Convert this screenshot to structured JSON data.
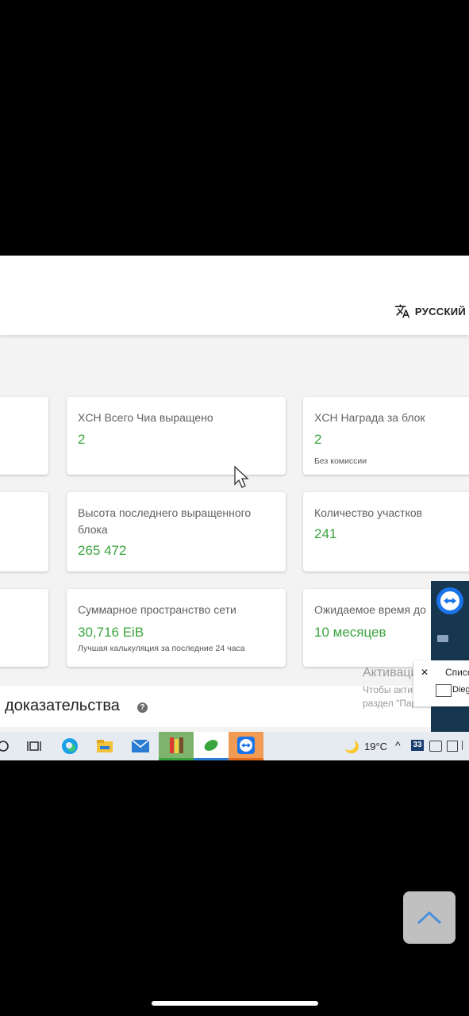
{
  "header": {
    "language_label": "РУССКИЙ",
    "language_icon": "translate-icon"
  },
  "stats": [
    {
      "label": "XCH Всего Чиа выращено",
      "value": "2",
      "note": ""
    },
    {
      "label": "XCH Награда за блок",
      "value": "2",
      "note": "Без комиссии"
    },
    {
      "label": "Высота последнего выращенного блока",
      "value": "265 472",
      "note": ""
    },
    {
      "label": "Количество участков",
      "value": "241",
      "note": ""
    },
    {
      "label": "Суммарное пространство сети",
      "value": "30,716 EiB",
      "note": "Лучшая калькуляция за последние 24 часа"
    },
    {
      "label": "Ожидаемое время до",
      "value": "10 месяцев",
      "note": ""
    }
  ],
  "section": {
    "title": "доказательства",
    "help_icon": "help-icon"
  },
  "windows_activation": {
    "title": "Активация Windo",
    "line1": "Чтобы активиров",
    "line2": "раздел \"Параметры\"."
  },
  "popup": {
    "label": "Списс",
    "user": "Diego"
  },
  "taskbar": {
    "weather": "19°C",
    "badge": "33",
    "icons": [
      "search-icon",
      "task-view-icon",
      "edge-icon",
      "file-explorer-icon",
      "mail-icon",
      "app-icon",
      "chia-icon",
      "teamviewer-icon"
    ]
  },
  "colors": {
    "value_green": "#3aa53f",
    "screen_background": "#f3f3f3",
    "taskbar": "#e6ebf1"
  }
}
